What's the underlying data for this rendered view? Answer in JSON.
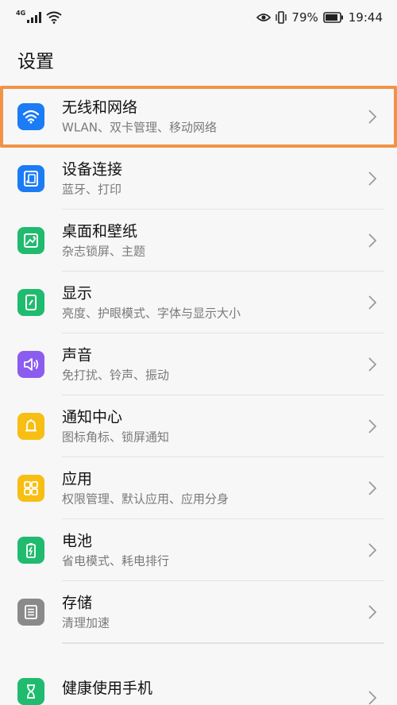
{
  "status": {
    "network": "4G",
    "battery": "79%",
    "time": "19:44"
  },
  "page": {
    "title": "设置"
  },
  "items": [
    {
      "title": "无线和网络",
      "subtitle": "WLAN、双卡管理、移动网络",
      "icon": "wifi-icon",
      "color": "#1b7cf5"
    },
    {
      "title": "设备连接",
      "subtitle": "蓝牙、打印",
      "icon": "device-connection-icon",
      "color": "#1b7cf5"
    },
    {
      "title": "桌面和壁纸",
      "subtitle": "杂志锁屏、主题",
      "icon": "wallpaper-icon",
      "color": "#20bb6f"
    },
    {
      "title": "显示",
      "subtitle": "亮度、护眼模式、字体与显示大小",
      "icon": "display-icon",
      "color": "#20bb6f"
    },
    {
      "title": "声音",
      "subtitle": "免打扰、铃声、振动",
      "icon": "sound-icon",
      "color": "#8b5cf0"
    },
    {
      "title": "通知中心",
      "subtitle": "图标角标、锁屏通知",
      "icon": "bell-icon",
      "color": "#f7be14"
    },
    {
      "title": "应用",
      "subtitle": "权限管理、默认应用、应用分身",
      "icon": "apps-icon",
      "color": "#f7be14"
    },
    {
      "title": "电池",
      "subtitle": "省电模式、耗电排行",
      "icon": "battery-icon",
      "color": "#20bb6f"
    },
    {
      "title": "存储",
      "subtitle": "清理加速",
      "icon": "storage-icon",
      "color": "#8a8a8a"
    },
    {
      "title": "健康使用手机",
      "subtitle": "",
      "icon": "hourglass-icon",
      "color": "#20bb6f"
    }
  ],
  "highlight_color": "#f09347"
}
